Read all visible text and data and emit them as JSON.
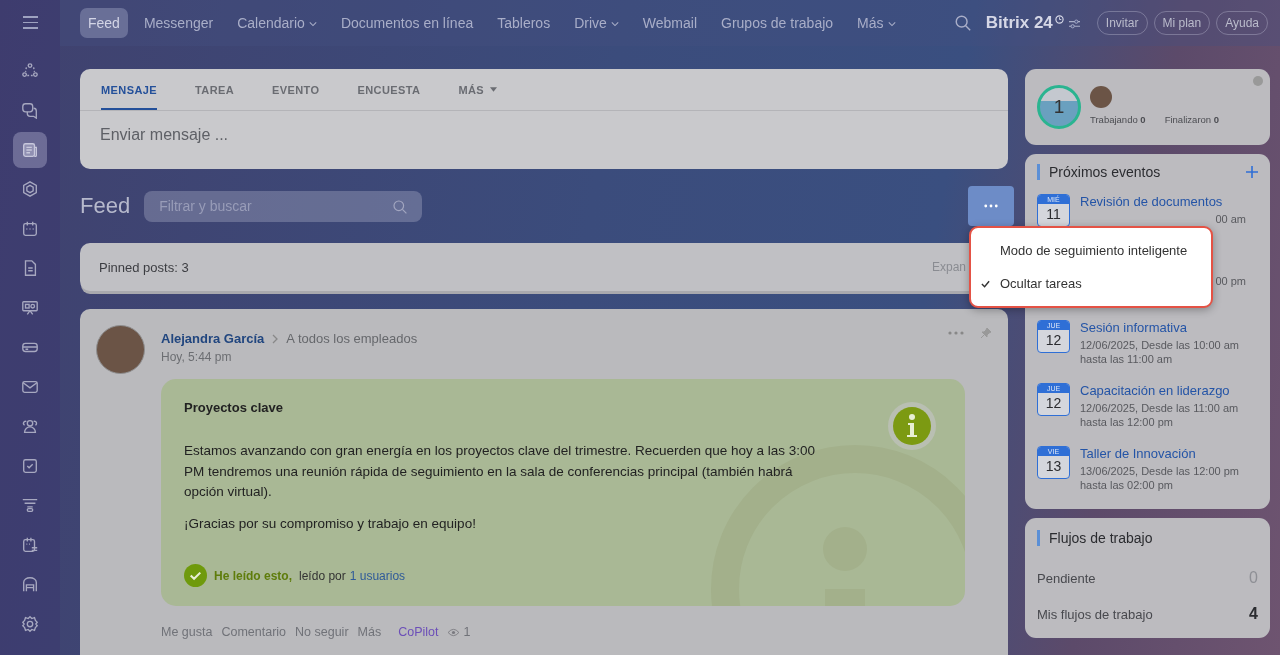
{
  "top_nav": {
    "items": [
      {
        "label": "Feed",
        "selected": true,
        "dropdown": false
      },
      {
        "label": "Messenger",
        "selected": false,
        "dropdown": false
      },
      {
        "label": "Calendario",
        "selected": false,
        "dropdown": true
      },
      {
        "label": "Documentos en línea",
        "selected": false,
        "dropdown": false
      },
      {
        "label": "Tableros",
        "selected": false,
        "dropdown": false
      },
      {
        "label": "Drive",
        "selected": false,
        "dropdown": true
      },
      {
        "label": "Webmail",
        "selected": false,
        "dropdown": false
      },
      {
        "label": "Grupos de trabajo",
        "selected": false,
        "dropdown": false
      },
      {
        "label": "Más",
        "selected": false,
        "dropdown": true
      }
    ],
    "logo": "Bitrix 24",
    "buttons": [
      "Invitar",
      "Mi plan",
      "Ayuda"
    ]
  },
  "sidebar": {
    "items": [
      {
        "selected": false
      },
      {
        "selected": false
      },
      {
        "selected": true
      },
      {
        "selected": false
      },
      {
        "selected": false
      },
      {
        "selected": false
      },
      {
        "selected": false
      },
      {
        "selected": false
      },
      {
        "selected": false
      },
      {
        "selected": false
      },
      {
        "selected": false
      },
      {
        "selected": false
      },
      {
        "selected": false
      },
      {
        "selected": false
      },
      {
        "selected": false
      }
    ]
  },
  "composer": {
    "tabs": [
      {
        "label": "MENSAJE",
        "selected": true,
        "dropdown": false
      },
      {
        "label": "TAREA",
        "selected": false,
        "dropdown": false
      },
      {
        "label": "EVENTO",
        "selected": false,
        "dropdown": false
      },
      {
        "label": "ENCUESTA",
        "selected": false,
        "dropdown": false
      },
      {
        "label": "MÁS",
        "selected": false,
        "dropdown": true
      }
    ],
    "placeholder": "Enviar mensaje ..."
  },
  "feed": {
    "title": "Feed",
    "search_placeholder": "Filtrar y buscar"
  },
  "menu": {
    "items": [
      {
        "label": "Modo de seguimiento inteligente",
        "checked": false
      },
      {
        "label": "Ocultar tareas",
        "checked": true
      }
    ]
  },
  "pinned": {
    "label": "Pinned posts: 3",
    "expand": "Expan"
  },
  "post": {
    "author": "Alejandra García",
    "audience": "A todos los empleados",
    "time": "Hoy, 5:44 pm",
    "title": "Proyectos clave",
    "paragraphs": [
      "Estamos avanzando con gran energía en los proyectos clave del trimestre. Recuerden que hoy a las 3:00 PM tendremos una reunión rápida de seguimiento en la sala de conferencias principal (también habrá opción virtual).",
      "¡Gracias por su compromiso y trabajo en equipo!"
    ],
    "read_label": "He leído esto,",
    "read_by": "leído por",
    "read_link": "1 usuarios",
    "actions": [
      "Me gusta",
      "Comentario",
      "No seguir",
      "Más"
    ],
    "copilot": "CoPilot",
    "views": "1"
  },
  "work_widget": {
    "count": "1",
    "working_label": "Trabajando",
    "working": "0",
    "finished_label": "Finalizaron",
    "finished": "0"
  },
  "events": {
    "title": "Próximos eventos",
    "items": [
      {
        "weekday": "MIÉ",
        "day": "11",
        "title": "Revisión de documentos",
        "lines": [
          "00 am"
        ]
      },
      {
        "lines": [
          "00 pm"
        ]
      },
      {
        "weekday": "JUE",
        "day": "12",
        "title": "Sesión informativa",
        "lines": [
          "12/06/2025, Desde las 10:00 am",
          "hasta las 11:00 am"
        ]
      },
      {
        "weekday": "JUE",
        "day": "12",
        "title": "Capacitación en liderazgo",
        "lines": [
          "12/06/2025, Desde las 11:00 am",
          "hasta las 12:00 pm"
        ]
      },
      {
        "weekday": "VIE",
        "day": "13",
        "title": "Taller de Innovación",
        "lines": [
          "13/06/2025, Desde las 12:00 pm",
          "hasta las 02:00 pm"
        ]
      }
    ]
  },
  "workflows": {
    "title": "Flujos de trabajo",
    "rows": [
      {
        "label": "Pendiente",
        "value": "0",
        "emphasis": false
      },
      {
        "label": "Mis flujos de trabajo",
        "value": "4",
        "emphasis": true
      }
    ]
  }
}
